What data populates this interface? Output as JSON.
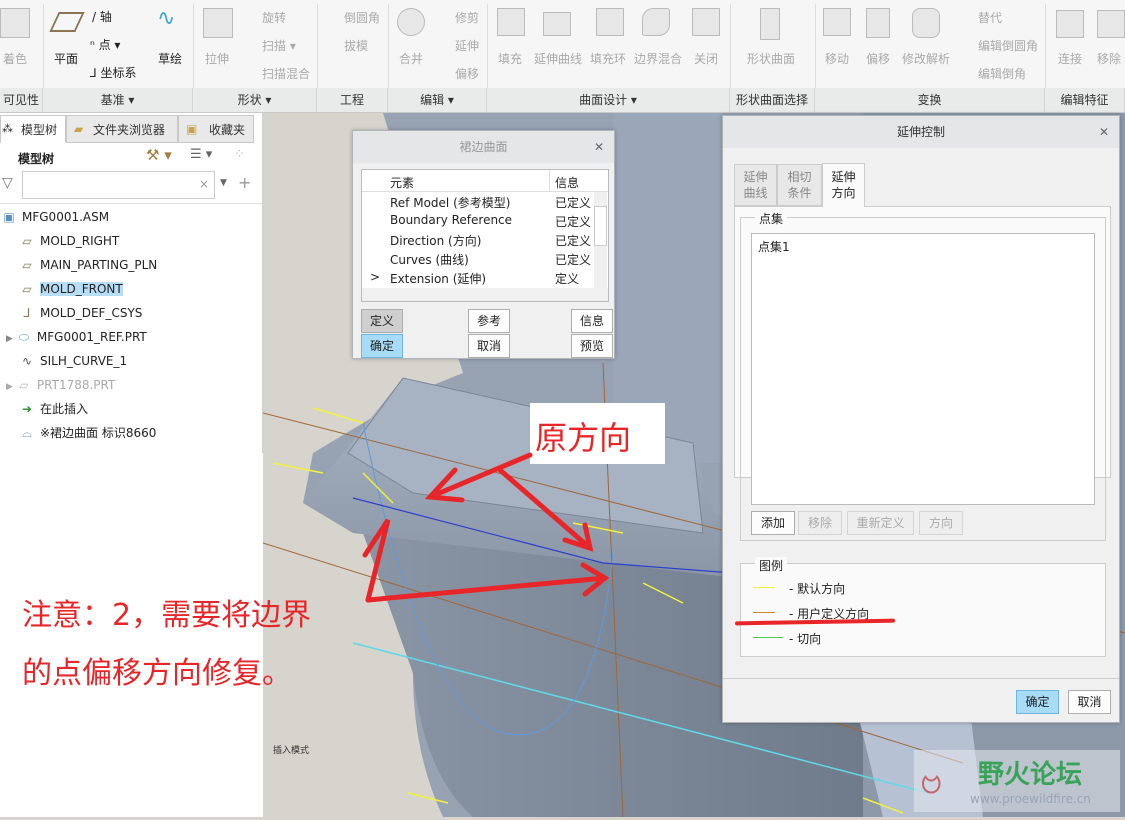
{
  "ribbon": {
    "groups": [
      {
        "label": "可见性"
      },
      {
        "label": "基准 ▾"
      },
      {
        "label": "形状 ▾"
      },
      {
        "label": "工程"
      },
      {
        "label": "编辑 ▾"
      },
      {
        "label": "曲面设计 ▾"
      },
      {
        "label": "形状曲面选择"
      },
      {
        "label": "变换"
      },
      {
        "label": "编辑特征"
      }
    ],
    "buttons": {
      "shade": "着色",
      "plane": "平面",
      "axis": "轴",
      "point": "点 ▾",
      "csys": "坐标系",
      "sketch": "草绘",
      "extrude": "拉伸",
      "revolve": "旋转",
      "sweep": "扫描 ▾",
      "swept_blend": "扫描混合",
      "round": "倒圆角",
      "draft": "拔模",
      "merge": "合并",
      "trim": "修剪",
      "extend": "延伸",
      "offset": "偏移",
      "fill": "填充",
      "extend_curve": "延伸曲线",
      "fill_loop": "填充环",
      "boundary_blend": "边界混合",
      "close": "关闭",
      "shape_surface": "形状曲面",
      "move": "移动",
      "offset2": "偏移",
      "modify_analytic": "修改解析",
      "substitute": "替代",
      "edit_round": "编辑倒圆角",
      "edit_chamfer": "编辑倒角",
      "connect": "连接",
      "remove": "移除"
    }
  },
  "left_panel": {
    "tabs": [
      "模型树",
      "文件夹浏览器",
      "收藏夹"
    ],
    "header": "模型树",
    "filter_placeholder": "",
    "tree": [
      {
        "label": "MFG0001.ASM",
        "icon": "assembly-icon"
      },
      {
        "label": "MOLD_RIGHT",
        "icon": "plane-icon"
      },
      {
        "label": "MAIN_PARTING_PLN",
        "icon": "plane-icon"
      },
      {
        "label": "MOLD_FRONT",
        "icon": "plane-icon",
        "selected": true
      },
      {
        "label": "MOLD_DEF_CSYS",
        "icon": "csys-icon"
      },
      {
        "label": "MFG0001_REF.PRT",
        "icon": "part-icon"
      },
      {
        "label": "SILH_CURVE_1",
        "icon": "curve-icon"
      },
      {
        "label": "PRT1788.PRT",
        "icon": "part-icon"
      },
      {
        "label": "在此插入",
        "icon": "insert-arrow-icon"
      },
      {
        "label": "※裙边曲面 标识8660",
        "icon": "skirt-surface-icon"
      }
    ]
  },
  "skirt_dialog": {
    "title": "裙边曲面",
    "columns": [
      "元素",
      "信息"
    ],
    "rows": [
      {
        "marker": "",
        "element": "Ref Model (参考模型)",
        "info": "已定义"
      },
      {
        "marker": "",
        "element": "Boundary Reference",
        "info": "已定义"
      },
      {
        "marker": "",
        "element": "Direction (方向)",
        "info": "已定义"
      },
      {
        "marker": "",
        "element": "Curves (曲线)",
        "info": "已定义"
      },
      {
        "marker": ">",
        "element": "Extension (延伸)",
        "info": "定义"
      }
    ],
    "buttons": {
      "define": "定义",
      "ok": "确定",
      "refs": "参考",
      "cancel": "取消",
      "info": "信息",
      "preview": "预览"
    }
  },
  "ext_dialog": {
    "title": "延伸控制",
    "tabs": [
      "延伸\n曲线",
      "相切\n条件",
      "延伸\n方向"
    ],
    "pointset_label": "点集",
    "pointsets": [
      "点集1"
    ],
    "buttons": {
      "add": "添加",
      "remove": "移除",
      "redefine": "重新定义",
      "direction": "方向",
      "ok": "确定",
      "cancel": "取消"
    },
    "legend_label": "图例",
    "legend": [
      {
        "label": "- 默认方向",
        "color": "#f2f23a"
      },
      {
        "label": "- 用户定义方向",
        "color": "#c88a2c"
      },
      {
        "label": "- 切向",
        "color": "#4ccc4c"
      }
    ]
  },
  "annotations": {
    "original_direction": "原方向",
    "note_line1": "注意：2，需要将边界",
    "note_line2": "的点偏移方向修复。",
    "mode_text": "插入模式",
    "red": "#e8262a"
  },
  "watermark": {
    "name": "野火论坛",
    "url": "www.proewildfire.cn"
  }
}
